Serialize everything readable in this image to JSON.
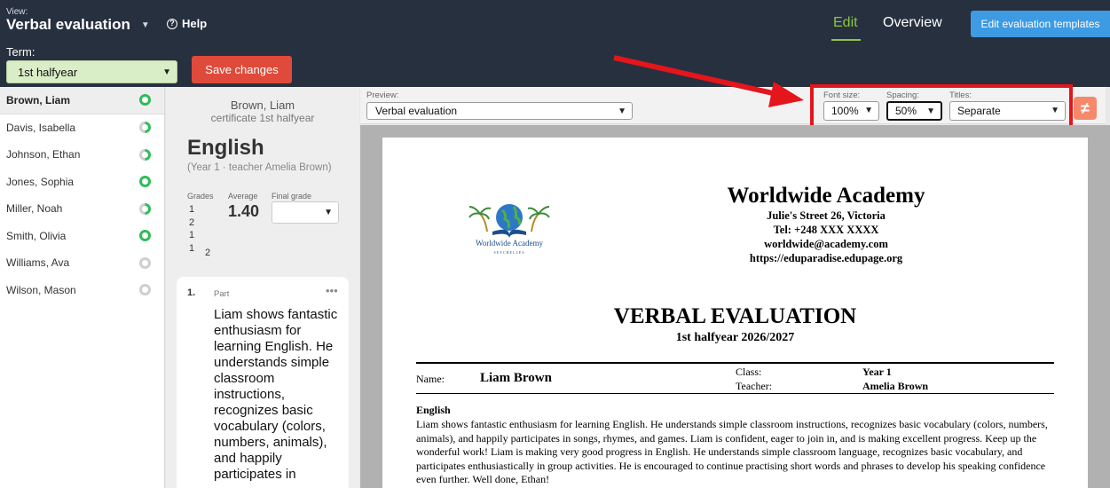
{
  "header": {
    "view_label": "View:",
    "view_title": "Verbal evaluation",
    "help": "Help",
    "nav_edit": "Edit",
    "nav_overview": "Overview",
    "templates_button": "Edit evaluation templates",
    "term_label": "Term:",
    "term_value": "1st halfyear",
    "save_button": "Save changes"
  },
  "students": [
    {
      "name": "Brown, Liam",
      "status": "done",
      "active": true
    },
    {
      "name": "Davis, Isabella",
      "status": "partial"
    },
    {
      "name": "Johnson, Ethan",
      "status": "partial"
    },
    {
      "name": "Jones, Sophia",
      "status": "done"
    },
    {
      "name": "Miller, Noah",
      "status": "partial"
    },
    {
      "name": "Smith, Olivia",
      "status": "done"
    },
    {
      "name": "Williams, Ava",
      "status": "none"
    },
    {
      "name": "Wilson, Mason",
      "status": "none"
    }
  ],
  "middle": {
    "student_name": "Brown, Liam",
    "certificate": "certificate 1st halfyear",
    "subject": "English",
    "subject_sub": "(Year 1 · teacher Amelia Brown)",
    "grades_label": "Grades",
    "average_label": "Average",
    "final_grade_label": "Final grade",
    "grades": [
      "1",
      "2",
      "1",
      "1"
    ],
    "grades_extra": "2",
    "average": "1.40",
    "part_number": "1.",
    "part_label": "Part",
    "part_text": "Liam shows fantastic enthusiasm for learning English. He understands simple classroom instructions, recognizes basic vocabulary (colors, numbers, animals), and happily participates in"
  },
  "preview": {
    "preview_label": "Preview:",
    "preview_value": "Verbal evaluation",
    "font_size_label": "Font size:",
    "font_size_value": "100%",
    "spacing_label": "Spacing:",
    "spacing_value": "50%",
    "titles_label": "Titles:",
    "titles_value": "Separate",
    "neq_symbol": "≠"
  },
  "document": {
    "logo_text": "Worldwide Academy",
    "logo_sub": "SEYCHELLES",
    "school_name": "Worldwide Academy",
    "address": "Julie's Street 26, Victoria",
    "tel": "Tel:  +248 XXX XXXX",
    "email": "worldwide@academy.com",
    "website": "https://eduparadise.edupage.org",
    "title": "VERBAL EVALUATION",
    "subtitle": "1st halfyear 2026/2027",
    "name_label": "Name:",
    "name_value": "Liam Brown",
    "class_label": "Class:",
    "class_value": "Year 1",
    "teacher_label": "Teacher:",
    "teacher_value": "Amelia Brown",
    "section_title": "English",
    "section_body": "Liam shows fantastic enthusiasm for learning English. He understands simple classroom instructions, recognizes basic vocabulary (colors, numbers, animals), and happily participates in songs, rhymes, and games. Liam is confident, eager to join in, and is making excellent progress. Keep up the wonderful work! Liam is making very good progress in English. He understands simple classroom language, recognizes basic vocabulary, and participates enthusiastically in group activities. He is encouraged to continue practising short words and phrases to develop his speaking confidence even further. Well done, Ethan!"
  },
  "colors": {
    "topbar": "#27303f",
    "accent_green": "#8dc63f",
    "save_red": "#e04a3a",
    "templates_blue": "#3d9be3",
    "annotation_red": "#e4151b",
    "status_green": "#2ebd59"
  }
}
